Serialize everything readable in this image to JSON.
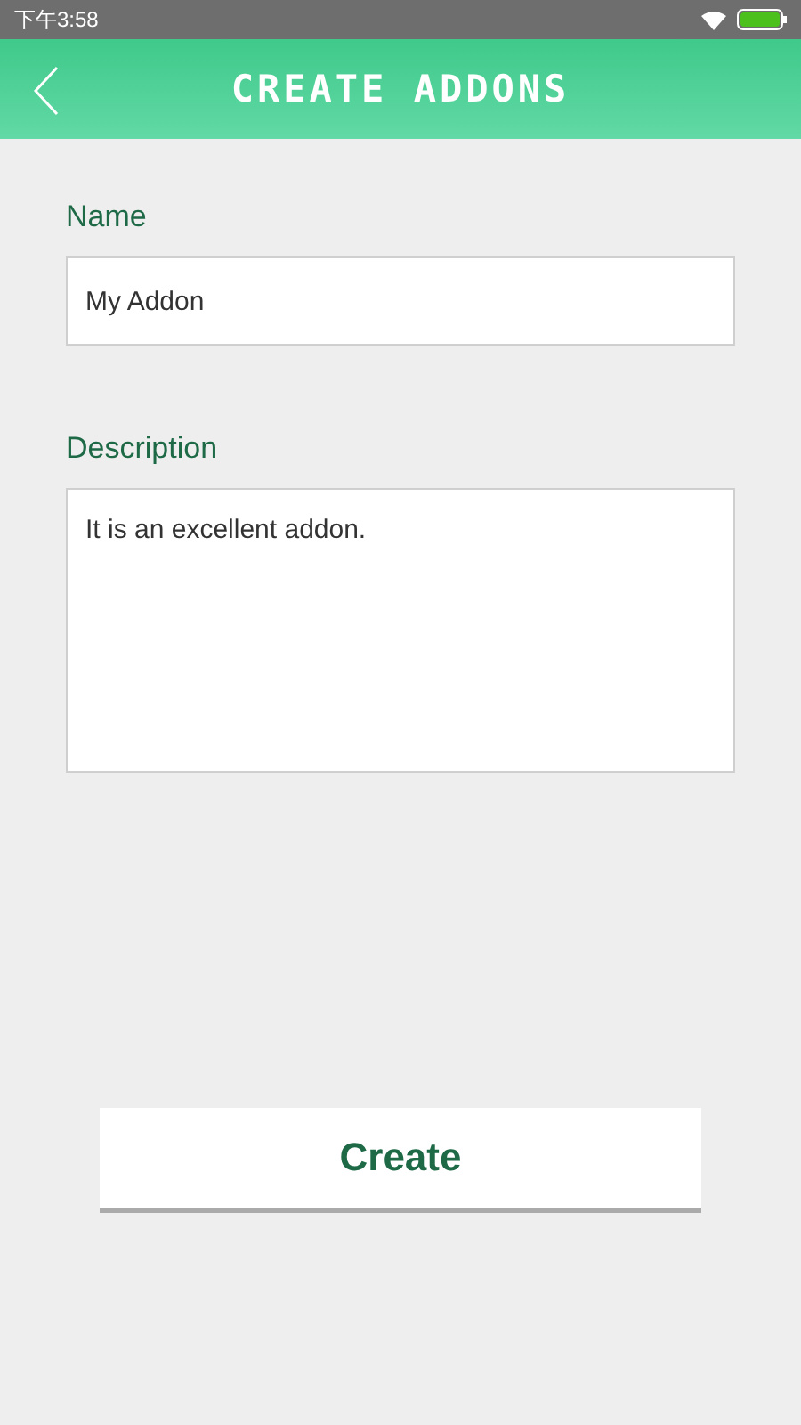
{
  "status_bar": {
    "time": "下午3:58"
  },
  "header": {
    "title": "CREATE ADDONS"
  },
  "form": {
    "fields": [
      {
        "kind": "line",
        "label": "Name",
        "value": "My Addon"
      },
      {
        "kind": "area",
        "label": "Description",
        "value": "It is an excellent addon."
      }
    ]
  },
  "button": {
    "label": "Create"
  }
}
